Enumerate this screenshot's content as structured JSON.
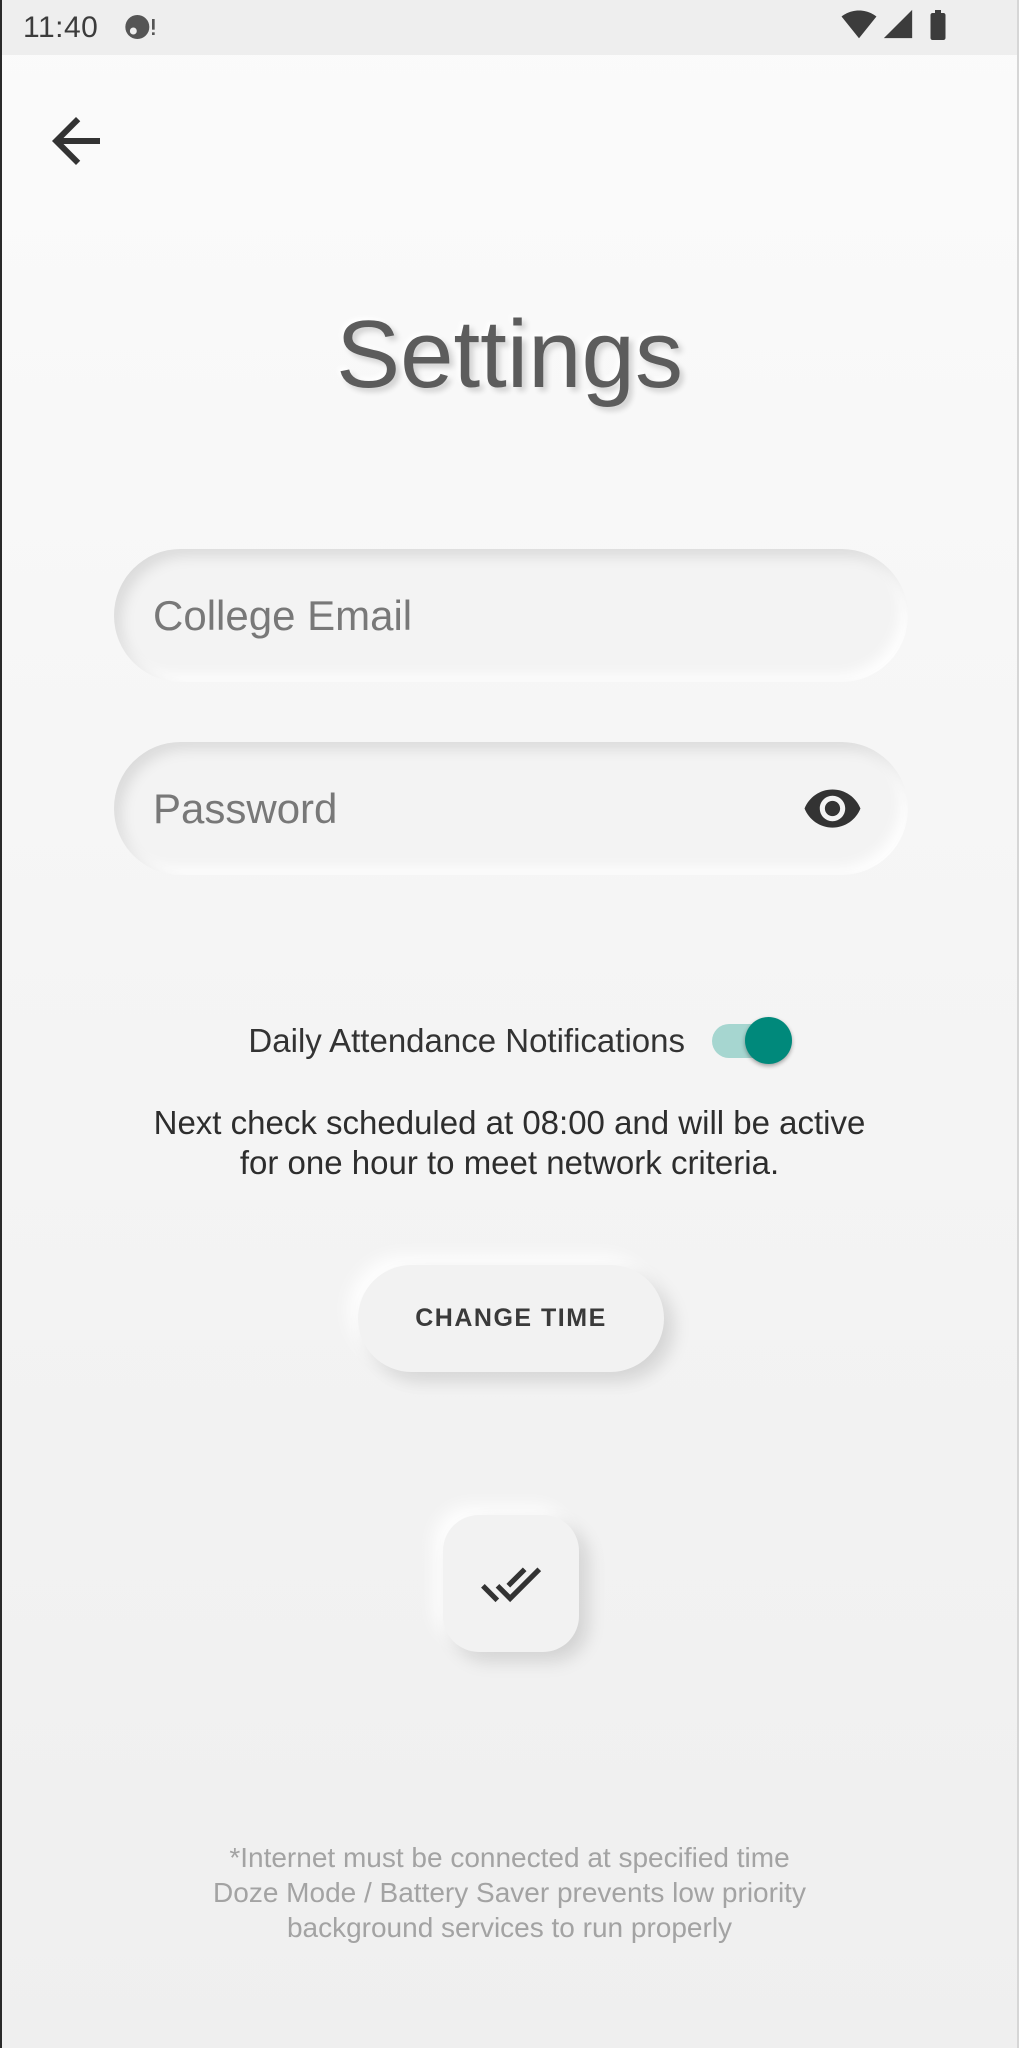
{
  "status_bar": {
    "time": "11:40",
    "icons": {
      "notification": "notification-icon",
      "wifi": "wifi-icon",
      "signal": "cellular-signal-icon",
      "battery": "battery-icon"
    }
  },
  "toolbar": {
    "back_icon": "arrow-back-icon"
  },
  "page_title": "Settings",
  "form": {
    "email": {
      "placeholder": "College Email",
      "value": ""
    },
    "password": {
      "placeholder": "Password",
      "value": "",
      "visibility_icon": "eye-icon"
    }
  },
  "notifications": {
    "label": "Daily Attendance Notifications",
    "enabled": true,
    "schedule_text": [
      "Next check scheduled at 08:00 and will be active",
      "for one hour to meet network criteria."
    ]
  },
  "change_time_button": {
    "label": "CHANGE TIME"
  },
  "save_button": {
    "icon": "double-check-icon"
  },
  "footer_note": [
    "*Internet must be connected at specified time",
    "Doze Mode / Battery Saver prevents low priority",
    "background services to run properly"
  ],
  "colors": {
    "accent": "#00897b",
    "accent_track": "#a6d6d0",
    "background": "#f4f4f4",
    "status_bar": "#eeeeee",
    "text_primary": "#333333",
    "text_hint": "#787878",
    "text_footer": "#a3a3a3"
  }
}
